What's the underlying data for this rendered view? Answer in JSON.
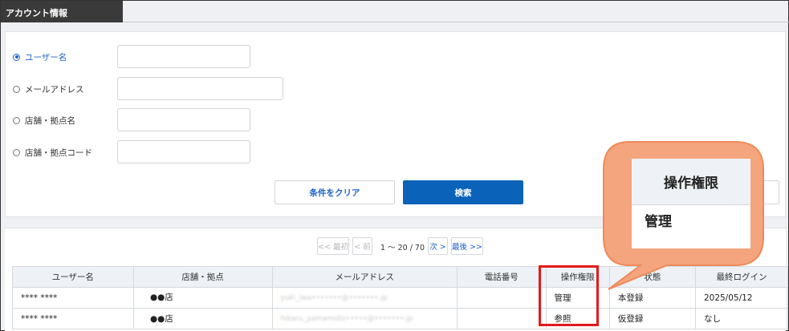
{
  "page": {
    "title": "アカウント情報"
  },
  "search": {
    "options": [
      {
        "label": "ユーザー名",
        "selected": true
      },
      {
        "label": "メールアドレス",
        "selected": false
      },
      {
        "label": "店舗・拠点名",
        "selected": false
      },
      {
        "label": "店舗・拠点コード",
        "selected": false
      }
    ],
    "clear_label": "条件をクリア",
    "search_label": "検索"
  },
  "pagination": {
    "first": "<< 最初",
    "prev": "< 前",
    "info": "1 〜 20 / 70",
    "next": "次 >",
    "last": "最後 >>"
  },
  "table": {
    "headers": [
      "ユーザー名",
      "店舗・拠点",
      "メールアドレス",
      "電話番号",
      "操作権限",
      "状態",
      "最終ログイン"
    ],
    "rows": [
      [
        "**** ****",
        "●●店",
        "yuki_iwa•••••••@•••••••.jp",
        "",
        "管理",
        "本登録",
        "2025/05/12"
      ],
      [
        "**** ****",
        "●●店",
        "hikaru_yamamoto•••••@•••••••.jp",
        "",
        "参照",
        "仮登録",
        "なし"
      ]
    ]
  },
  "callout": {
    "header": "操作権限",
    "value": "管理",
    "accent": "#f4a57d",
    "highlight": "#e31a1a"
  }
}
